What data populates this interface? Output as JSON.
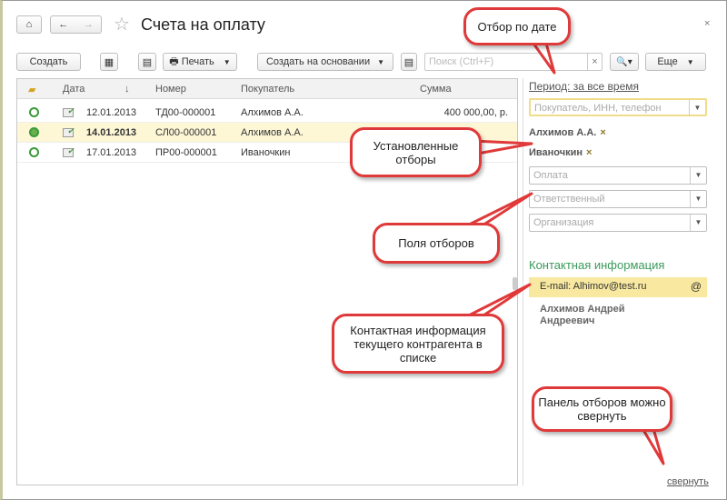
{
  "title": "Счета на оплату",
  "toolbar": {
    "create": "Создать",
    "print": "Печать",
    "create_based": "Создать на основании",
    "search_placeholder": "Поиск (Ctrl+F)",
    "more": "Еще",
    "clear": "×",
    "close": "×"
  },
  "table": {
    "columns": [
      "Дата",
      "↓",
      "Номер",
      "Покупатель",
      "Сумма"
    ],
    "rows": [
      {
        "date": "12.01.2013",
        "number": "ТД00-000001",
        "buyer": "Алхимов А.А.",
        "sum": "400 000,00, р.",
        "selected": false
      },
      {
        "date": "14.01.2013",
        "number": "СЛ00-000001",
        "buyer": "Алхимов А.А.",
        "sum": "",
        "selected": true
      },
      {
        "date": "17.01.2013",
        "number": "ПР00-000001",
        "buyer": "Иваночкин",
        "sum": "",
        "selected": false
      }
    ]
  },
  "panel": {
    "period": "Период: за все время",
    "buyer_placeholder": "Покупатель, ИНН, телефон",
    "chips": [
      "Алхимов А.А.",
      "Иваночкин"
    ],
    "chip_remove": "×",
    "fields": [
      "Оплата",
      "Ответственный",
      "Организация"
    ],
    "contact_title": "Контактная информация",
    "email": "E-mail: Alhimov@test.ru",
    "email_icon": "@",
    "contact_name": "Алхимов Андрей Андреевич",
    "collapse": "свернуть"
  },
  "callouts": [
    "Отбор по дате",
    "Установленные отборы",
    "Поля отборов",
    "Контактная информация текущего контрагента в списке",
    "Панель отборов можно свернуть"
  ]
}
